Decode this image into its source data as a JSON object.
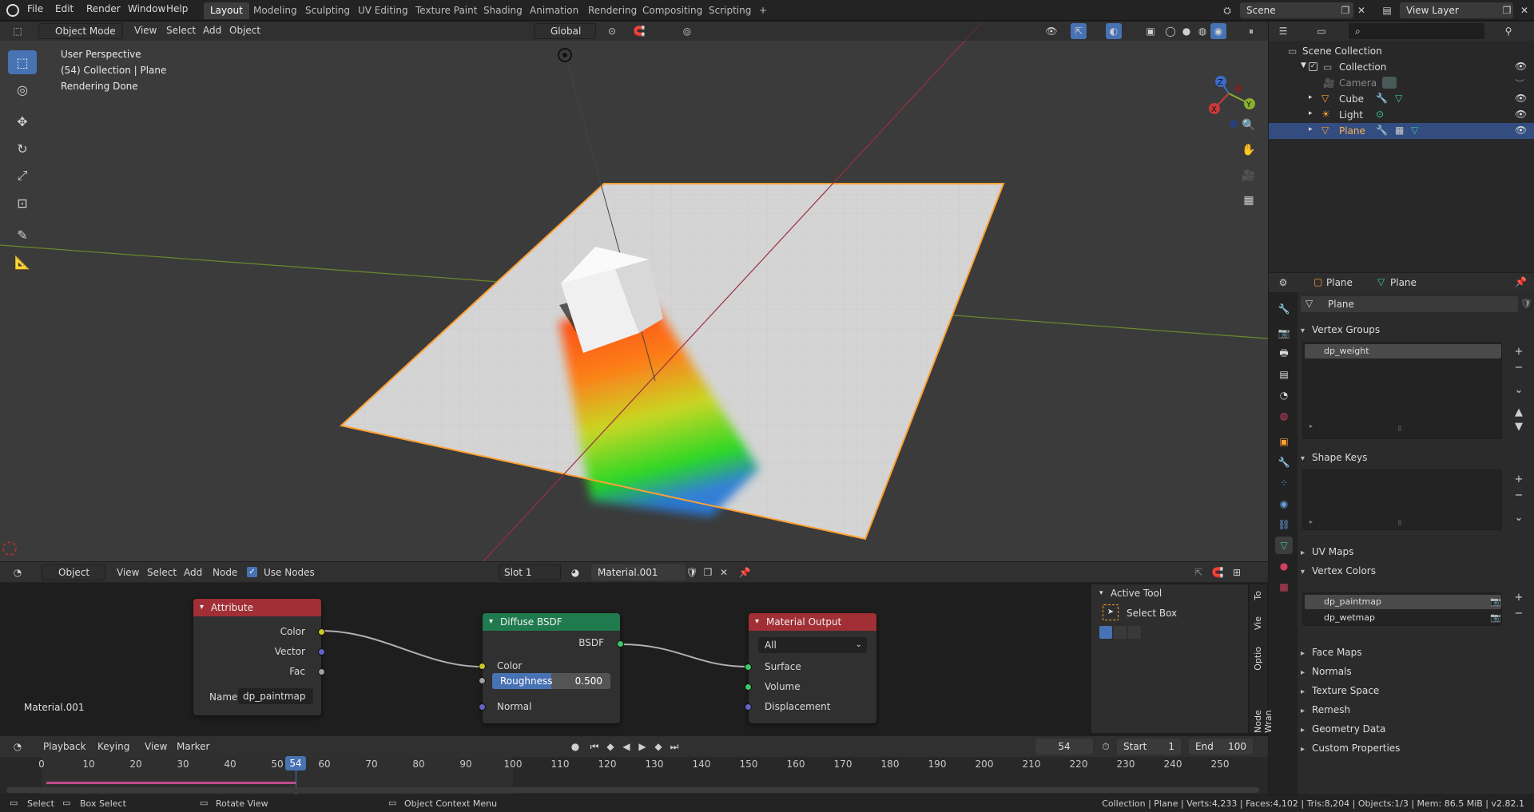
{
  "topbar": {
    "menus": [
      "File",
      "Edit",
      "Render",
      "Window",
      "Help"
    ],
    "workspaces": [
      "Layout",
      "Modeling",
      "Sculpting",
      "UV Editing",
      "Texture Paint",
      "Shading",
      "Animation",
      "Rendering",
      "Compositing",
      "Scripting"
    ],
    "active_workspace": "Layout",
    "add_tab": "+",
    "scene": "Scene",
    "view_layer": "View Layer"
  },
  "viewport": {
    "mode": "Object Mode",
    "menus": [
      "View",
      "Select",
      "Add",
      "Object"
    ],
    "orientation": "Global",
    "overlay_lines": [
      "User Perspective",
      "(54) Collection | Plane",
      "Rendering Done"
    ],
    "gizmo_axes": {
      "x": "X",
      "y": "Y",
      "z": "Z"
    }
  },
  "outliner": {
    "search_placeholder": "",
    "items": [
      {
        "label": "Scene Collection",
        "indent": 0
      },
      {
        "label": "Collection",
        "indent": 1
      },
      {
        "label": "Camera",
        "indent": 2
      },
      {
        "label": "Cube",
        "indent": 2
      },
      {
        "label": "Light",
        "indent": 2
      },
      {
        "label": "Plane",
        "indent": 2
      }
    ]
  },
  "properties": {
    "breadcrumb": [
      "Plane",
      "Plane"
    ],
    "data_name": "Plane",
    "panels": {
      "vertex_groups": "Vertex Groups",
      "shape_keys": "Shape Keys",
      "uv_maps": "UV Maps",
      "vertex_colors": "Vertex Colors",
      "face_maps": "Face Maps",
      "normals": "Normals",
      "texture_space": "Texture Space",
      "remesh": "Remesh",
      "geometry_data": "Geometry Data",
      "custom_properties": "Custom Properties"
    },
    "vertex_groups_items": [
      "dp_weight"
    ],
    "vertex_colors_items": [
      "dp_paintmap",
      "dp_wetmap"
    ]
  },
  "node_editor": {
    "type": "Object",
    "menus": [
      "View",
      "Select",
      "Add",
      "Node"
    ],
    "use_nodes_label": "Use Nodes",
    "slot": "Slot 1",
    "material": "Material.001",
    "material_label": "Material.001",
    "attribute_node": {
      "title": "Attribute",
      "outputs": [
        "Color",
        "Vector",
        "Fac"
      ],
      "name_label": "Name:",
      "name_value": "dp_paintmap"
    },
    "diffuse_node": {
      "title": "Diffuse BSDF",
      "output": "BSDF",
      "inputs": [
        "Color",
        "Normal"
      ],
      "roughness_label": "Roughness",
      "roughness_value": "0.500"
    },
    "output_node": {
      "title": "Material Output",
      "target": "All",
      "inputs": [
        "Surface",
        "Volume",
        "Displacement"
      ]
    },
    "sidebar": {
      "title": "Active Tool",
      "tool": "Select Box",
      "tabs": [
        "Node Wran",
        "Optio",
        "Vie",
        "To"
      ]
    }
  },
  "timeline": {
    "menus": [
      "Playback",
      "Keying",
      "View",
      "Marker"
    ],
    "current_frame": "54",
    "start_label": "Start",
    "start": "1",
    "end_label": "End",
    "end": "100",
    "ticks": [
      "0",
      "10",
      "20",
      "30",
      "40",
      "50",
      "60",
      "70",
      "80",
      "90",
      "100",
      "110",
      "120",
      "130",
      "140",
      "150",
      "160",
      "170",
      "180",
      "190",
      "200",
      "210",
      "220",
      "230",
      "240",
      "250"
    ],
    "playhead_label": "54"
  },
  "statusbar": {
    "select": "Select",
    "box_select": "Box Select",
    "rotate_view": "Rotate View",
    "context_menu": "Object Context Menu",
    "stats": "Collection | Plane | Verts:4,233 | Faces:4,102 | Tris:8,204 | Objects:1/3 | Mem: 86.5 MiB | v2.82.1"
  },
  "colors": {
    "accent": "#4772b3",
    "selection_orange": "#ffa033",
    "attribute_header": "#a12f35",
    "shader_header": "#1f7a4e",
    "output_header": "#a12f35"
  }
}
